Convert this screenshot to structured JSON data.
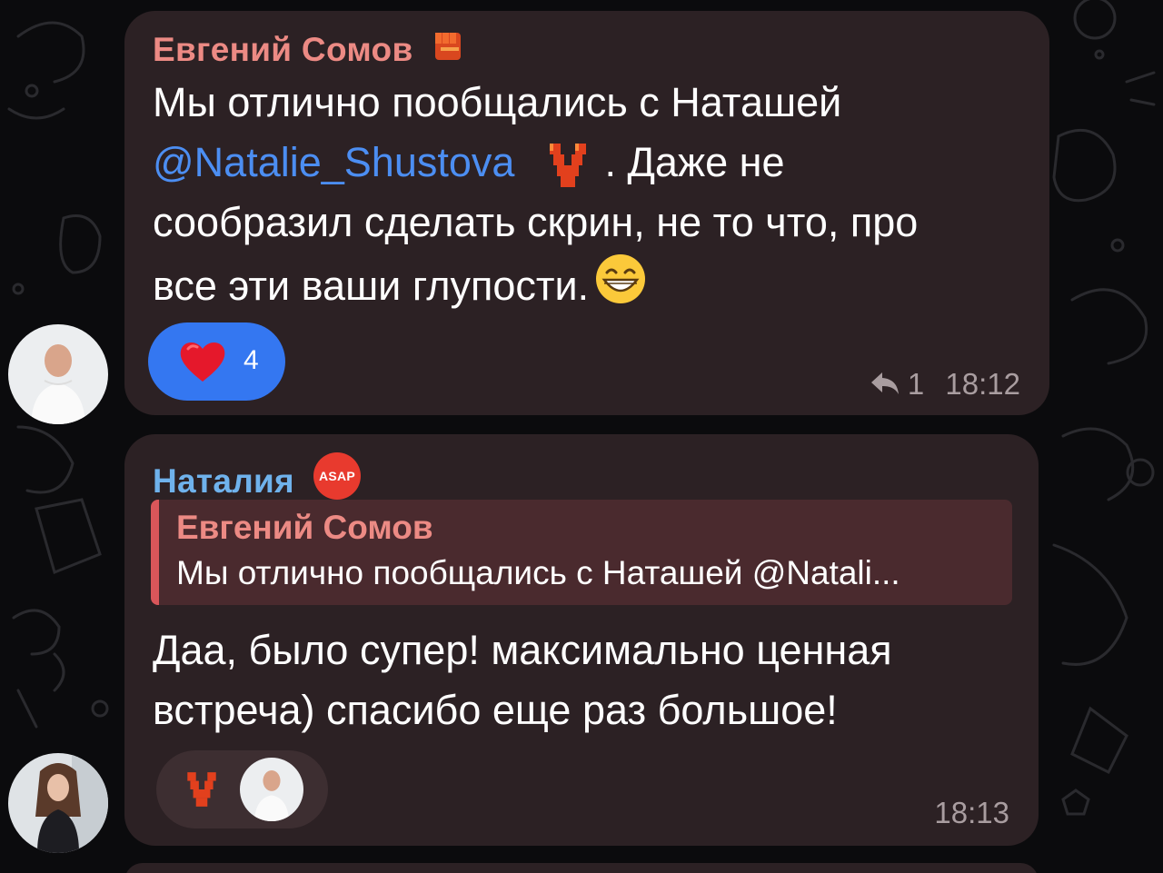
{
  "messages": [
    {
      "sender": "Евгений Сомов",
      "text_line1": "Мы отлично пообщались с Наташей",
      "mention": "@Natalie_Shustova",
      "text_after_mention": ". Даже не",
      "text_line3": "сообразил сделать скрин, не то что, про",
      "text_line4": "все эти ваши глупости.",
      "reaction_count": "4",
      "reply_count": "1",
      "time": "18:12"
    },
    {
      "sender": "Наталия",
      "badge_text": "ASAP",
      "quote_author": "Евгений Сомов",
      "quote_text": "Мы отлично пообщались с Наташей @Natali...",
      "text_line1": "Даа, было супер! максимально ценная",
      "text_line2": "встреча) спасибо еще раз большое!",
      "time": "18:13"
    }
  ],
  "colors": {
    "background": "#0b0b0d",
    "bubble": "#2c2124",
    "sender1": "#ec8a84",
    "sender2": "#6fb2ec",
    "mention": "#4c8ef2",
    "reaction_pill": "#3477f1",
    "quote_bar": "#d9565a"
  },
  "icons": [
    "raised-fist-icon",
    "pixel-v-emoji-icon",
    "grinning-face-emoji",
    "red-heart-icon",
    "reply-arrow-icon",
    "asap-badge-icon"
  ]
}
